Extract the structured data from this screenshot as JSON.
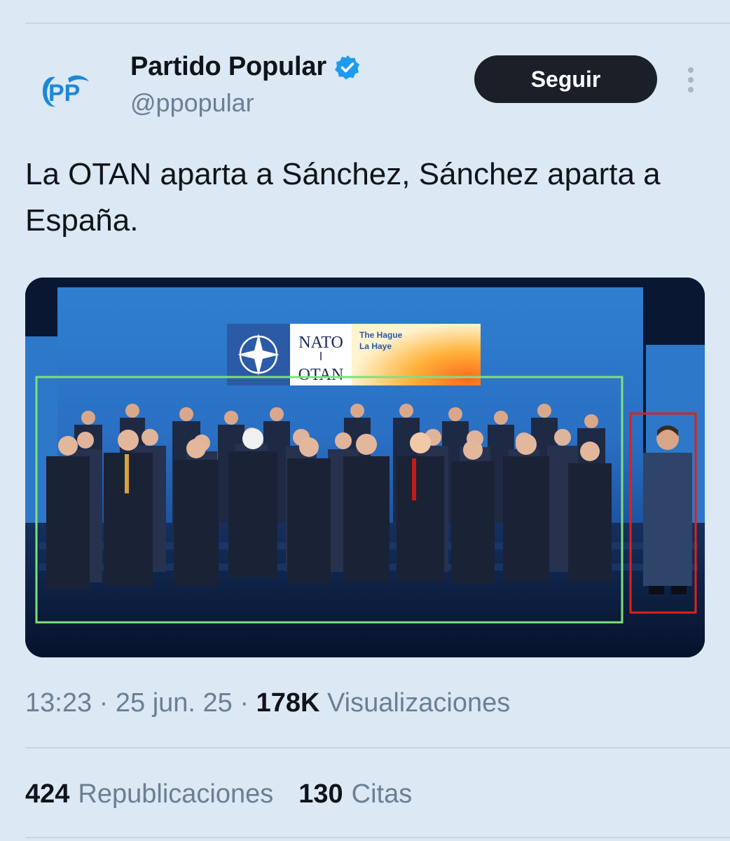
{
  "tweet": {
    "author": {
      "display_name": "Partido Popular",
      "handle": "@ppopular",
      "verified": true,
      "avatar_logo_text": "PP"
    },
    "follow_label": "Seguir",
    "text": "La OTAN aparta a Sánchez, Sánchez aparta a España.",
    "media": {
      "banner_nato": "NATO",
      "banner_otan": "OTAN",
      "banner_city_en": "The Hague",
      "banner_city_fr": "La Haye",
      "highlight_colors": {
        "group_box": "#7fe07a",
        "single_box": "#e0201c"
      }
    },
    "time": "13:23",
    "date": "25 jun. 25",
    "views_count": "178K",
    "views_label": "Visualizaciones",
    "reposts_count": "424",
    "reposts_label": "Republicaciones",
    "quotes_count": "130",
    "quotes_label": "Citas"
  },
  "icons": [
    "pp-logo-icon",
    "verified-badge-icon",
    "more-options-icon"
  ],
  "colors": {
    "background": "#dce8f4",
    "follow_button": "#1b2028",
    "verified": "#1d9bf0",
    "secondary_text": "#6b7f93"
  }
}
